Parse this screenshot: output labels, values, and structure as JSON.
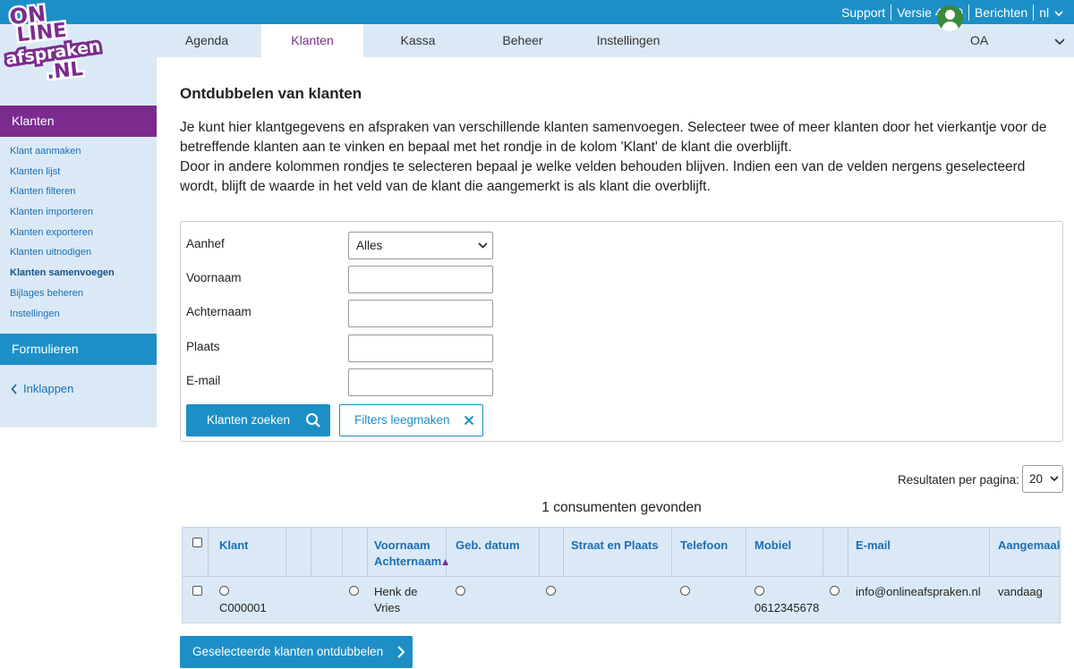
{
  "top_links": {
    "support": "Support",
    "version": "Versie 4.8.0",
    "messages": "Berichten",
    "language": "nl"
  },
  "logo": {
    "line1": "ON",
    "line2": "LINE",
    "line3": "afspraken",
    "line4": ".NL"
  },
  "nav": {
    "tabs": [
      "Agenda",
      "Klanten",
      "Kassa",
      "Beheer",
      "Instellingen"
    ],
    "active": "Klanten",
    "user": "OA"
  },
  "sidebar": {
    "section1": "Klanten",
    "items": [
      "Klant aanmaken",
      "Klanten lijst",
      "Klanten filteren",
      "Klanten importeren",
      "Klanten exporteren",
      "Klanten uitnodigen",
      "Klanten samenvoegen",
      "Bijlages beheren",
      "Instellingen"
    ],
    "active_item": "Klanten samenvoegen",
    "section2": "Formulieren",
    "collapse": "Inklappen"
  },
  "main": {
    "title": "Ontdubbelen van klanten",
    "intro1": "Je kunt hier klantgegevens en afspraken van verschillende klanten samenvoegen. Selecteer twee of meer klanten door het vierkantje voor de betreffende klanten aan te vinken en bepaal met het rondje in de kolom 'Klant' de klant die overblijft.",
    "intro2": "Door in andere kolommen rondjes te selecteren bepaal je welke velden behouden blijven. Indien een van de velden nergens geselecteerd wordt, blijft de waarde in het veld van de klant die aangemerkt is als klant die overblijft."
  },
  "filters": {
    "aanhef_label": "Aanhef",
    "aanhef_value": "Alles",
    "voornaam_label": "Voornaam",
    "achternaam_label": "Achternaam",
    "plaats_label": "Plaats",
    "email_label": "E-mail",
    "search_button": "Klanten zoeken",
    "clear_button": "Filters leegmaken"
  },
  "results": {
    "per_page_label": "Resultaten per pagina:",
    "per_page_value": "20",
    "found_text": "1 consumenten gevonden"
  },
  "table": {
    "headers": {
      "klant": "Klant",
      "voornaam": "Voornaam",
      "achternaam": "Achternaam",
      "geb_datum": "Geb. datum",
      "straat_plaats": "Straat en Plaats",
      "telefoon": "Telefoon",
      "mobiel": "Mobiel",
      "email": "E-mail",
      "aangemaakt": "Aangemaakt"
    },
    "rows": [
      {
        "klant": "C000001",
        "naam1": "Henk de",
        "naam2": "Vries",
        "mobiel": "0612345678",
        "email": "info@onlineafspraken.nl",
        "aangemaakt": "vandaag"
      }
    ]
  },
  "merge_button": "Geselecteerde klanten ontdubbelen",
  "colors": {
    "primary_blue": "#1d8fc7",
    "purple": "#7b2b8e",
    "light_blue": "#dbe9f6"
  }
}
